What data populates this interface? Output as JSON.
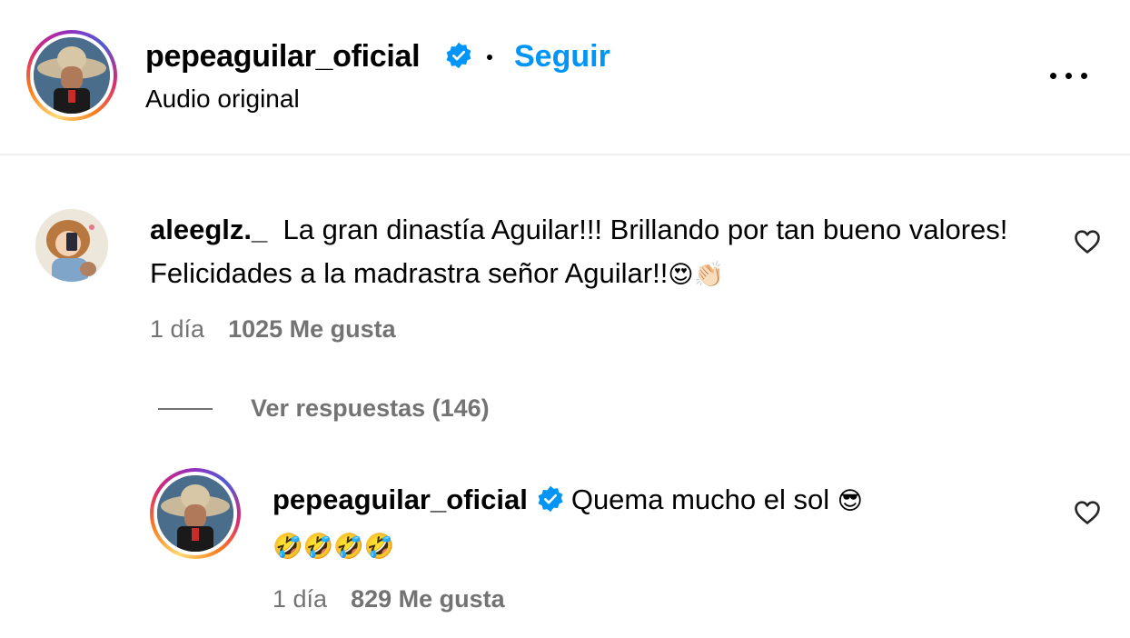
{
  "header": {
    "username": "pepeaguilar_oficial",
    "separator": "•",
    "follow_label": "Seguir",
    "subtitle": "Audio original",
    "more_icon": "more-horizontal-icon"
  },
  "comments": [
    {
      "username": "aleeglz._",
      "text": "La gran dinastía Aguilar!!! Brillando por tan bueno valores! Felicidades a la madrastra señor Aguilar!!",
      "emojis": "😍👏🏻",
      "time": "1 día",
      "likes": "1025 Me gusta",
      "like_icon": "heart-outline-icon"
    }
  ],
  "view_replies": "Ver respuestas (146)",
  "reply": {
    "username": "pepeaguilar_oficial",
    "text": "Quema mucho el sol",
    "emoji_inline": "😎",
    "emoji_line2": "🤣🤣🤣🤣",
    "time": "1 día",
    "likes": "829 Me gusta",
    "like_icon": "heart-outline-icon"
  },
  "colors": {
    "follow_blue": "#0095f6",
    "verified_blue": "#0095f6",
    "muted_gray": "#737373"
  }
}
